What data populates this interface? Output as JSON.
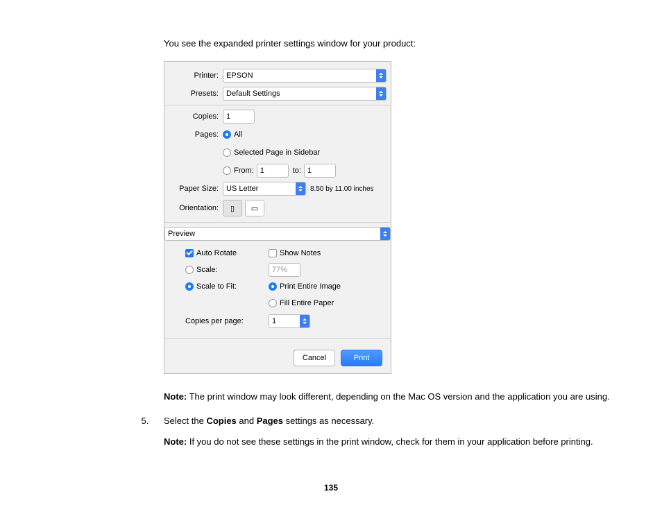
{
  "intro": "You see the expanded printer settings window for your product:",
  "dialog": {
    "labels": {
      "printer": "Printer:",
      "presets": "Presets:",
      "copies": "Copies:",
      "pages": "Pages:",
      "paper_size": "Paper Size:",
      "orientation": "Orientation:"
    },
    "printer": "EPSON",
    "presets": "Default Settings",
    "copies": "1",
    "pages": {
      "all": "All",
      "selected": "Selected Page in Sidebar",
      "from_label": "From:",
      "from": "1",
      "to_label": "to:",
      "to": "1"
    },
    "paper_size": "US Letter",
    "paper_dim": "8.50 by 11.00 inches",
    "orientation_icons": {
      "portrait": "⬆",
      "landscape": "↪"
    },
    "section": "Preview",
    "options": {
      "auto_rotate": "Auto Rotate",
      "show_notes": "Show Notes",
      "scale": "Scale:",
      "scale_value": "77%",
      "scale_to_fit": "Scale to Fit:",
      "print_entire": "Print Entire Image",
      "fill_entire": "Fill Entire Paper",
      "copies_per_page": "Copies per page:",
      "copies_per_page_value": "1"
    },
    "buttons": {
      "cancel": "Cancel",
      "print": "Print"
    }
  },
  "note1_label": "Note:",
  "note1_text": " The print window may look different, depending on the Mac OS version and the application you are using.",
  "step_number": "5.",
  "step_text_a": "Select the ",
  "step_text_b": "Copies",
  "step_text_c": " and ",
  "step_text_d": "Pages",
  "step_text_e": " settings as necessary.",
  "note2_label": "Note:",
  "note2_text": " If you do not see these settings in the print window, check for them in your application before printing.",
  "page_number": "135"
}
